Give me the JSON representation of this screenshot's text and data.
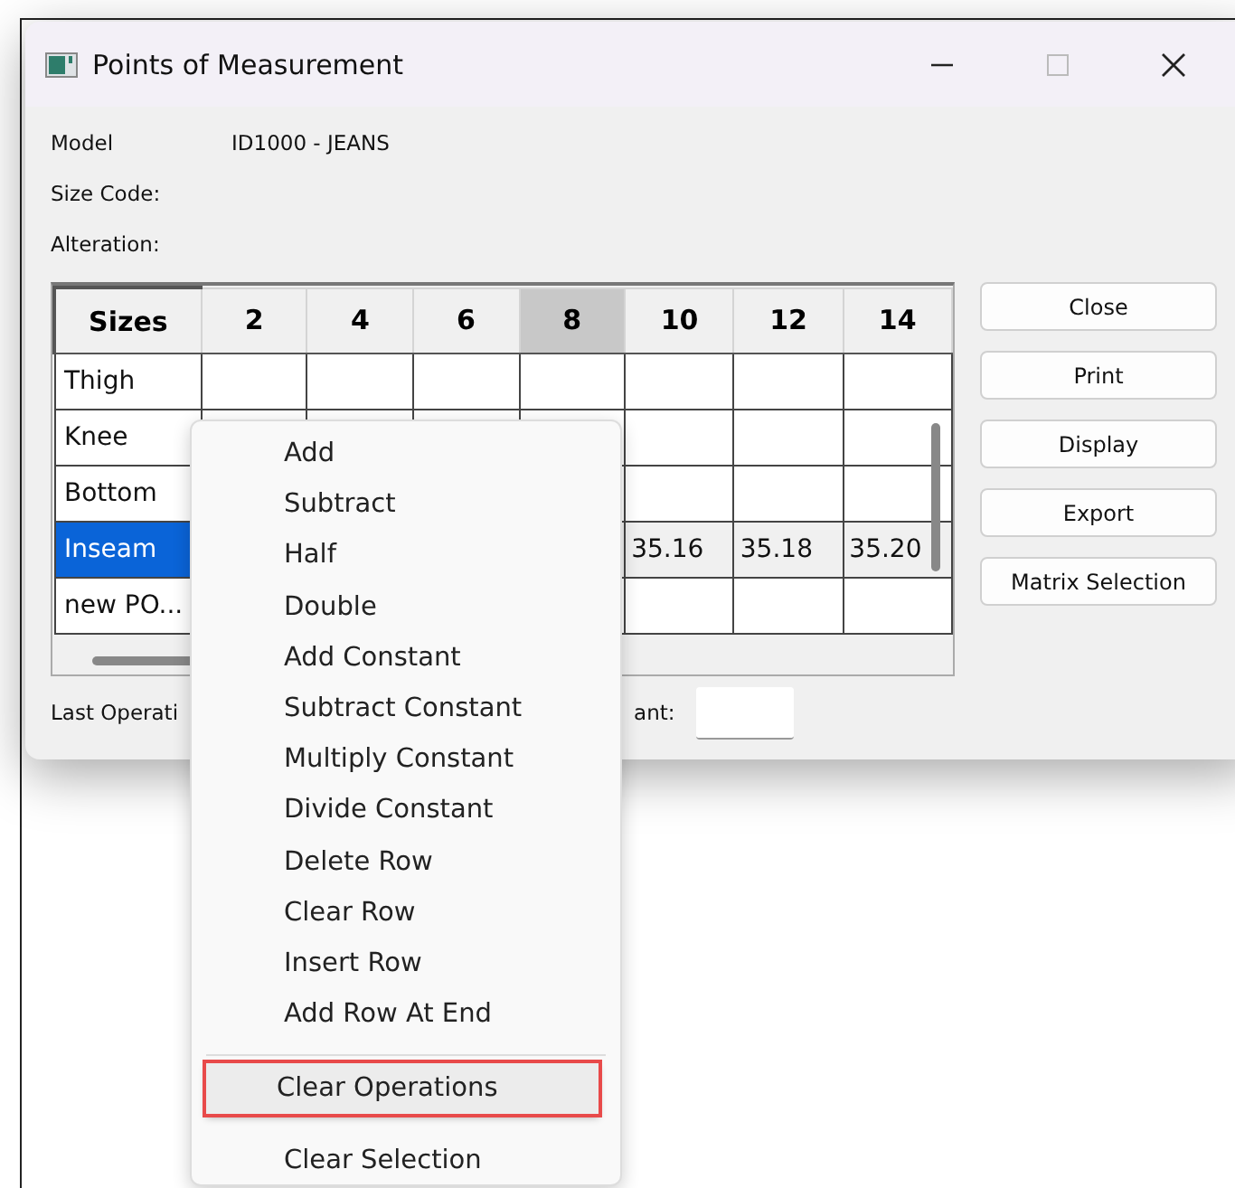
{
  "window": {
    "title": "Points of Measurement"
  },
  "fields": [
    {
      "label": "Model",
      "value": "ID1000 - JEANS"
    },
    {
      "label": "Size Code:"
    },
    {
      "label": "Alteration:"
    }
  ],
  "table": {
    "columns": [
      {
        "label": "Sizes",
        "selected": false
      },
      {
        "label": "2",
        "selected": false
      },
      {
        "label": "4",
        "selected": false
      },
      {
        "label": "6",
        "selected": false
      },
      {
        "label": "8",
        "selected": true
      },
      {
        "label": "10",
        "selected": false
      },
      {
        "label": "12",
        "selected": false
      },
      {
        "label": "14",
        "selected": false
      }
    ],
    "rows": [
      {
        "name": "Thigh",
        "selected": false,
        "values": []
      },
      {
        "name": "Knee",
        "selected": false,
        "values": []
      },
      {
        "name": "Bottom",
        "selected": false,
        "values": []
      },
      {
        "name": "Inseam",
        "selected": true,
        "values": [
          "35.16",
          "35.18",
          "35.20"
        ]
      },
      {
        "name": "new PO...",
        "selected": false,
        "values": []
      }
    ]
  },
  "buttons": [
    "Close",
    "Print",
    "Display",
    "Export",
    "Matrix Selection"
  ],
  "footer": {
    "last_operation_label": "Last Operati",
    "constant_label": "ant:"
  },
  "context_menu": [
    {
      "kind": "item",
      "label": "Add",
      "selected": false
    },
    {
      "kind": "item",
      "label": "Subtract",
      "selected": false
    },
    {
      "kind": "item",
      "label": "Half",
      "selected": false
    },
    {
      "kind": "item",
      "label": "Double",
      "selected": false
    },
    {
      "kind": "item",
      "label": "Add Constant",
      "selected": false
    },
    {
      "kind": "item",
      "label": "Subtract Constant",
      "selected": false
    },
    {
      "kind": "item",
      "label": "Multiply Constant",
      "selected": false
    },
    {
      "kind": "item",
      "label": "Divide Constant",
      "selected": false
    },
    {
      "kind": "item",
      "label": "Delete Row",
      "selected": false
    },
    {
      "kind": "item",
      "label": "Clear Row",
      "selected": false
    },
    {
      "kind": "item",
      "label": "Insert Row",
      "selected": false
    },
    {
      "kind": "item",
      "label": "Add Row At End",
      "selected": false
    },
    {
      "kind": "separator"
    },
    {
      "kind": "item",
      "label": "Clear Operations",
      "selected": true
    },
    {
      "kind": "item",
      "label": "Clear Selection",
      "selected": false
    }
  ]
}
